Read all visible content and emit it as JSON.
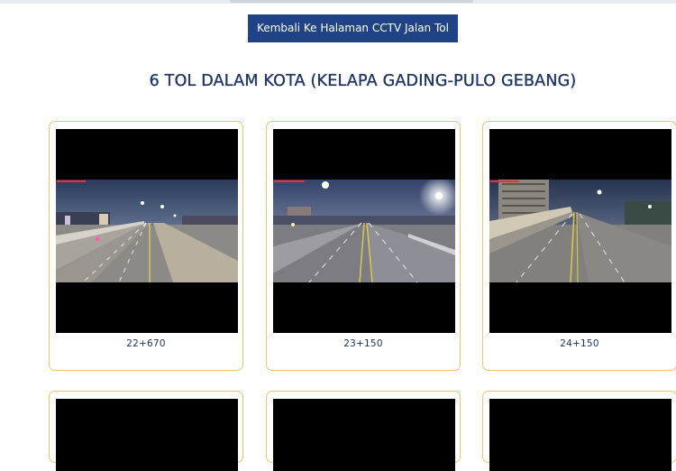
{
  "nav": {
    "back_button_label": "Kembali Ke Halaman CCTV Jalan Tol"
  },
  "page": {
    "title": "6 TOL DALAM KOTA (KELAPA GADING-PULO GEBANG)"
  },
  "cameras": [
    {
      "label": "22+670"
    },
    {
      "label": "23+150"
    },
    {
      "label": "24+150"
    },
    {
      "label": ""
    },
    {
      "label": ""
    },
    {
      "label": ""
    }
  ],
  "colors": {
    "button_bg": "#1f4386",
    "title_text": "#1e3565",
    "card_border": "#f0c56a"
  }
}
